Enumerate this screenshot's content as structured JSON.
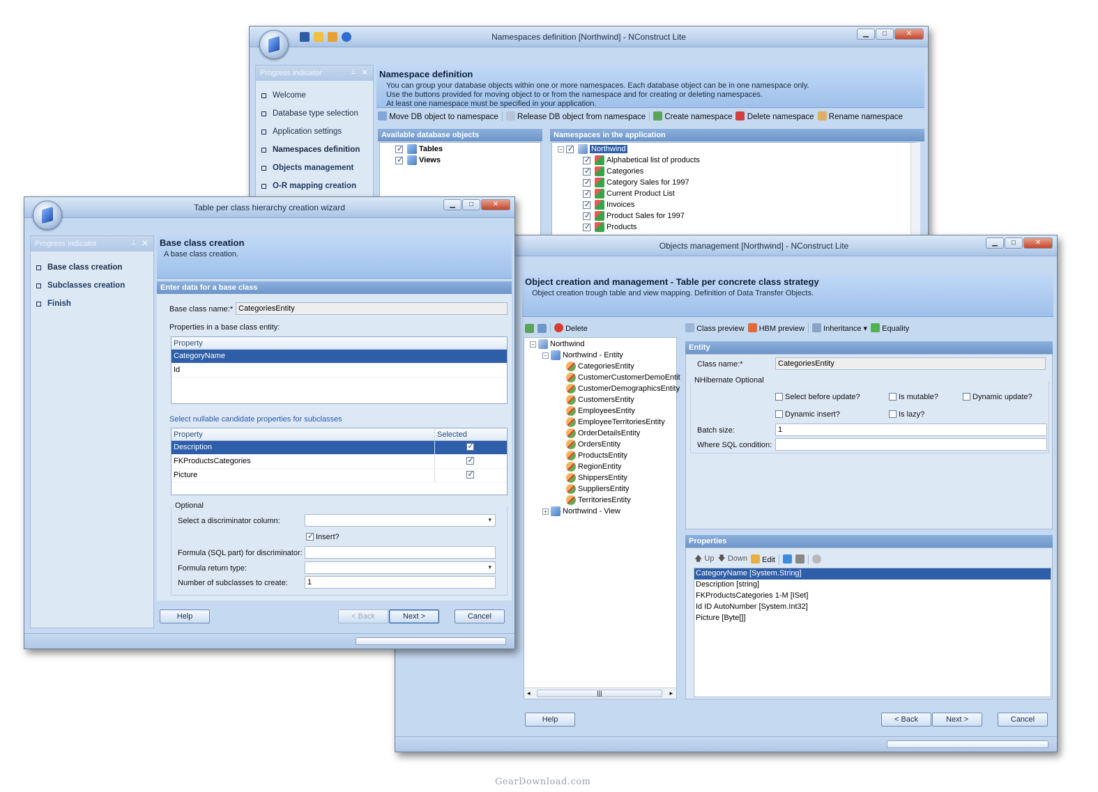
{
  "win_ns": {
    "title": "Namespaces definition [Northwind] - NConstruct  Lite",
    "progress_header": "Progress indicator",
    "steps": [
      "Welcome",
      "Database type selection",
      "Application settings",
      "Namespaces definition",
      "Objects management",
      "O-R mapping creation"
    ],
    "heading": "Namespace definition",
    "desc": [
      "You can group your database objects within one or more namespaces. Each database object can be in one namespace only.",
      "Use the buttons provided for moving object to or from the namespace and for creating or deleting namespaces.",
      "At least one namespace must be specified in your application."
    ],
    "toolbar": [
      "Move DB object to namespace",
      "Release DB object from namespace",
      "Create namespace",
      "Delete namespace",
      "Rename namespace"
    ],
    "available_header": "Available database objects",
    "available": [
      "Tables",
      "Views"
    ],
    "namespaces_header": "Namespaces in the application",
    "ns_root": "Northwind",
    "ns_items": [
      "Alphabetical list of products",
      "Categories",
      "Category Sales for 1997",
      "Current Product List",
      "Invoices",
      "Product Sales for 1997",
      "Products"
    ]
  },
  "win_wiz": {
    "title": "Table per class hierarchy creation wizard",
    "progress_header": "Progress indicator",
    "steps": [
      "Base class creation",
      "Subclasses creation",
      "Finish"
    ],
    "heading": "Base class creation",
    "desc": "A base class creation.",
    "section": "Enter data for a base class",
    "base_name_label": "Base class name:*",
    "base_name_value": "CategoriesEntity",
    "props_label": "Properties in a base class entity:",
    "props_header": "Property",
    "props_rows": [
      "CategoryName",
      "Id"
    ],
    "nullable_label": "Select nullable candidate properties for subclasses",
    "null_headers": [
      "Property",
      "Selected"
    ],
    "null_rows": [
      "Description",
      "FKProductsCategories",
      "Picture"
    ],
    "optional_label": "Optional",
    "disc_label": "Select a discriminator column:",
    "insert_label": "Insert?",
    "formula_label": "Formula (SQL part) for discriminator:",
    "return_label": "Formula return type:",
    "subcount_label": "Number of subclasses to create:",
    "subcount_value": "1",
    "btn_help": "Help",
    "btn_back": "< Back",
    "btn_next": "Next >",
    "btn_cancel": "Cancel"
  },
  "win_obj": {
    "title": "Objects management [Northwind] - NConstruct  Lite",
    "heading": "Object creation and management - Table per concrete class strategy",
    "desc": "Object creation trough table and view mapping. Definition of Data Transfer Objects.",
    "left_toolbar_delete": "Delete",
    "tree_root": "Northwind",
    "tree_entity": "Northwind - Entity",
    "entities": [
      "CategoriesEntity",
      "CustomerCustomerDemoEntit",
      "CustomerDemographicsEntity",
      "CustomersEntity",
      "EmployeesEntity",
      "EmployeeTerritoriesEntity",
      "OrderDetailsEntity",
      "OrdersEntity",
      "ProductsEntity",
      "RegionEntity",
      "ShippersEntity",
      "SuppliersEntity",
      "TerritoriesEntity"
    ],
    "tree_view": "Northwind - View",
    "right_toolbar": [
      "Class preview",
      "HBM preview",
      "Inheritance",
      "Equality"
    ],
    "entity_header": "Entity",
    "class_name_label": "Class name:*",
    "class_name_value": "CategoriesEntity",
    "nh_optional": "NHibernate Optional",
    "chk_select": "Select before update?",
    "chk_mutable": "Is mutable?",
    "chk_dynupdate": "Dynamic update?",
    "chk_dyninsert": "Dynamic insert?",
    "chk_lazy": "Is lazy?",
    "batch_label": "Batch size:",
    "batch_value": "1",
    "where_label": "Where SQL condition:",
    "props_header": "Properties",
    "props_toolbar": [
      "Up",
      "Down",
      "Edit"
    ],
    "props": [
      "CategoryName  [System.String]",
      "Description  [string]",
      "FKProductsCategories 1-M [ISet]",
      "Id ID AutoNumber [System.Int32]",
      "Picture  [Byte[]]"
    ],
    "btn_help": "Help",
    "btn_back": "< Back",
    "btn_next": "Next >",
    "btn_cancel": "Cancel"
  },
  "watermark": "GearDownload.com",
  "colors": {
    "accent_selected": "#2f5ea8",
    "panel": "#c5d9f1",
    "section_bar": "#6d95c9"
  }
}
